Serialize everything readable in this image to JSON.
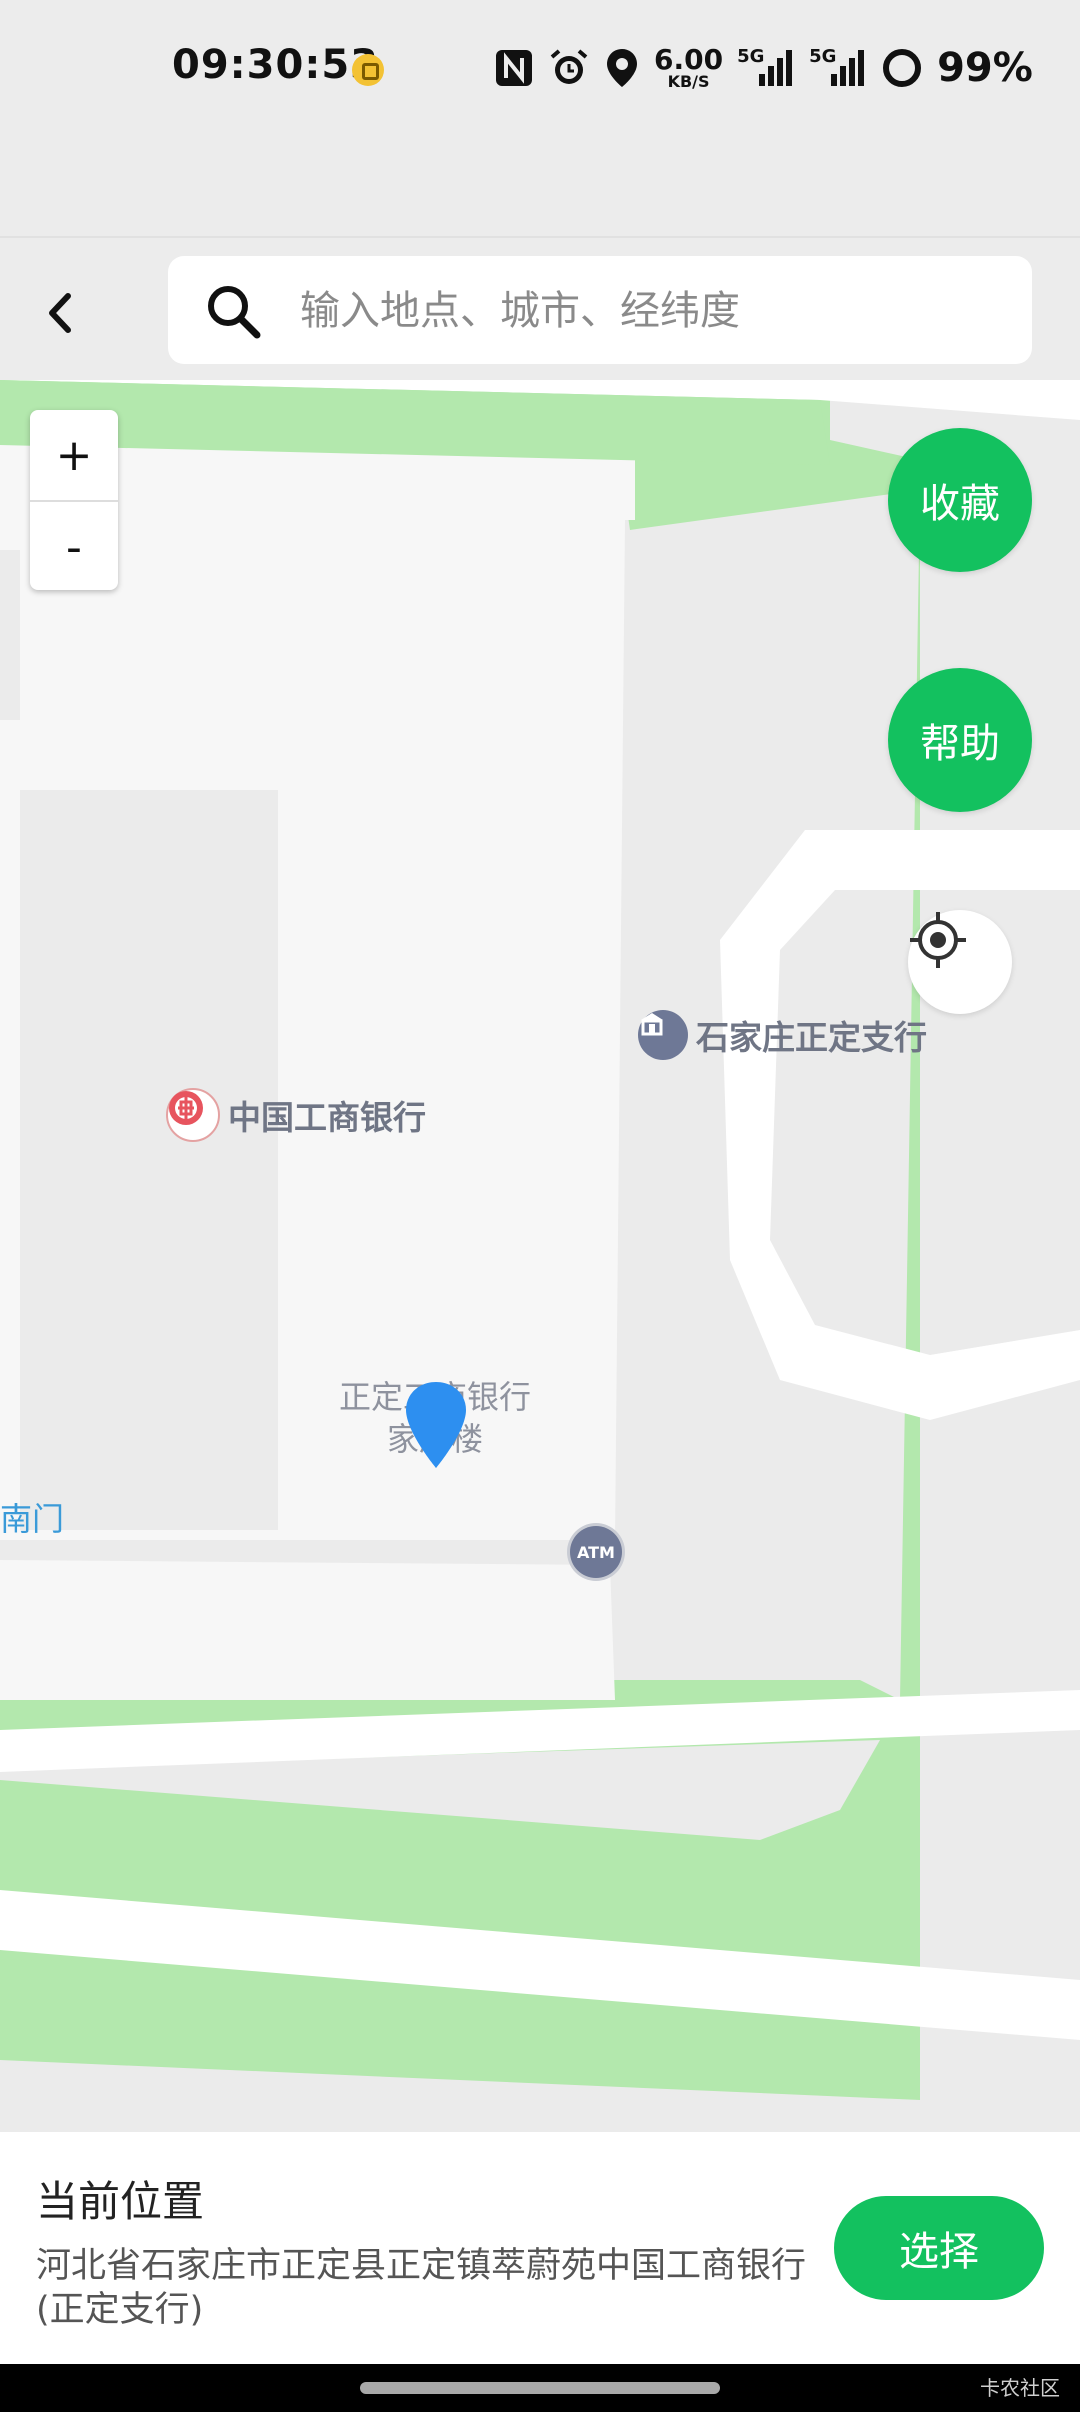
{
  "status_bar": {
    "time": "09:30:53",
    "net_speed_value": "6.00",
    "net_speed_unit": "KB/S",
    "signal_label_1": "5G",
    "signal_label_2": "5G",
    "battery": "99%",
    "icons": [
      "nfc-icon",
      "alarm-icon",
      "location-icon",
      "signal-5g-icon",
      "signal-5g-icon",
      "battery-icon"
    ]
  },
  "search": {
    "placeholder": "输入地点、城市、经纬度"
  },
  "map": {
    "zoom_in_label": "+",
    "zoom_out_label": "-",
    "favorite_label": "收藏",
    "help_label": "帮助",
    "pois": {
      "icbc": "中国工商银行",
      "branch": "石家庄正定支行",
      "building_line1": "正定工商银行",
      "building_line2": "家属楼",
      "gate": "南门",
      "atm": "ATM"
    },
    "colors": {
      "green_area": "#b3e8ad",
      "road": "#ffffff",
      "block": "#f7f7f7",
      "pin": "#2d8ff0"
    }
  },
  "bottom_panel": {
    "title": "当前位置",
    "address": "河北省石家庄市正定县正定镇萃蔚苑中国工商银行(正定支行)",
    "select_label": "选择"
  },
  "nav_bar": {
    "watermark": "卡农社区"
  }
}
